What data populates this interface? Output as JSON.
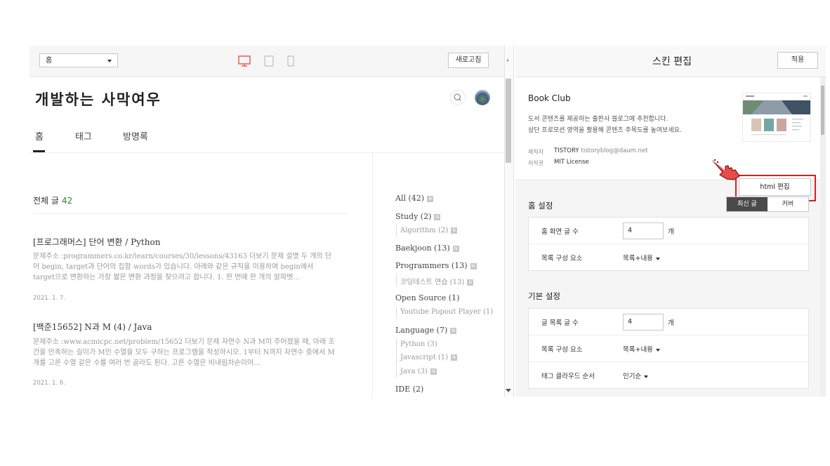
{
  "toolbar": {
    "page_select": "홈",
    "refresh_label": "새로고침"
  },
  "blog": {
    "title": "개발하는 사막여우",
    "nav": [
      "홈",
      "태그",
      "방명록"
    ],
    "all_posts_label": "전체 글",
    "all_posts_count": "42",
    "posts": [
      {
        "title": "[프로그래머스] 단어 변환 / Python",
        "excerpt": "문제주소 :programmers.co.kr/learn/courses/30/lessons/43163 더보기 문제 설명 두 개의 단어 begin, target과 단어의 집합 words가 있습니다. 아래와 같은 규칙을 이용하여 begin에서 target으로 변환하는 가장 짧은 변환 과정을 찾으려고 합니다. 1. 한 번에 한 개의 알파벳…",
        "date": "2021. 1. 7."
      },
      {
        "title": "[백준15652] N과 M (4) / Java",
        "excerpt": "문제주소 :www.acmicpc.net/problem/15652 더보기 문제 자연수 N과 M이 주어졌을 때, 아래 조건을 만족하는 길이가 M인 수열을 모두 구하는 프로그램을 작성하시오. 1부터 N까지 자연수 중에서 M개를 고른 수열 같은 수를 여러 번 골라도 된다. 고른 수열은 비내림차순이어…",
        "date": "2021. 1. 6."
      }
    ],
    "categories": [
      {
        "label": "All (42)",
        "badge": "N"
      },
      {
        "label": "Study (2)",
        "badge": "N"
      },
      {
        "label": "Algorithm (2)",
        "badge": "N"
      },
      {
        "label": "Baekjoon (13)",
        "badge": "N"
      },
      {
        "label": "Programmers (13)",
        "badge": "N"
      },
      {
        "label": "코딩테스트 연습 (13)",
        "badge": "N"
      },
      {
        "label": "Open Source (1)"
      },
      {
        "label": "Youtube Popout Player (1)"
      },
      {
        "label": "Language (7)",
        "badge": "N"
      },
      {
        "label": "Python (3)"
      },
      {
        "label": "Javascript (1)",
        "badge": "N"
      },
      {
        "label": "Java (3)",
        "badge": "N"
      },
      {
        "label": "IDE (2)"
      }
    ]
  },
  "editor": {
    "title": "스킨 편집",
    "apply_label": "적용",
    "skin": {
      "name": "Book Club",
      "desc1": "도서 콘텐츠를 제공하는 출판사 블로그에 추천합니다.",
      "desc2": "상단 프로모션 영역을 활용해 콘텐츠 주목도를 높여보세요.",
      "maker_label": "제작자",
      "maker": "TISTORY",
      "maker_email": "tistoryblog@daum.net",
      "license_label": "저작권",
      "license": "MIT License",
      "html_edit_label": "html 편집"
    },
    "home": {
      "section_title": "홈 설정",
      "seg_latest": "최신 글",
      "seg_cover": "커버",
      "post_count_label": "홈 화면 글 수",
      "post_count": "4",
      "unit": "개",
      "list_label": "목록 구성 요소",
      "list_value": "목록+내용"
    },
    "basic": {
      "section_title": "기본 설정",
      "post_count_label": "글 목록 글 수",
      "post_count": "4",
      "unit": "개",
      "list_label": "목록 구성 요소",
      "list_value": "목록+내용",
      "tag_label": "태그 클라우드 순서",
      "tag_value": "인기순"
    }
  },
  "colors": {
    "accent_green": "#2a8a2a",
    "highlight_red": "#d81f1f",
    "device_active": "#e8534a"
  }
}
